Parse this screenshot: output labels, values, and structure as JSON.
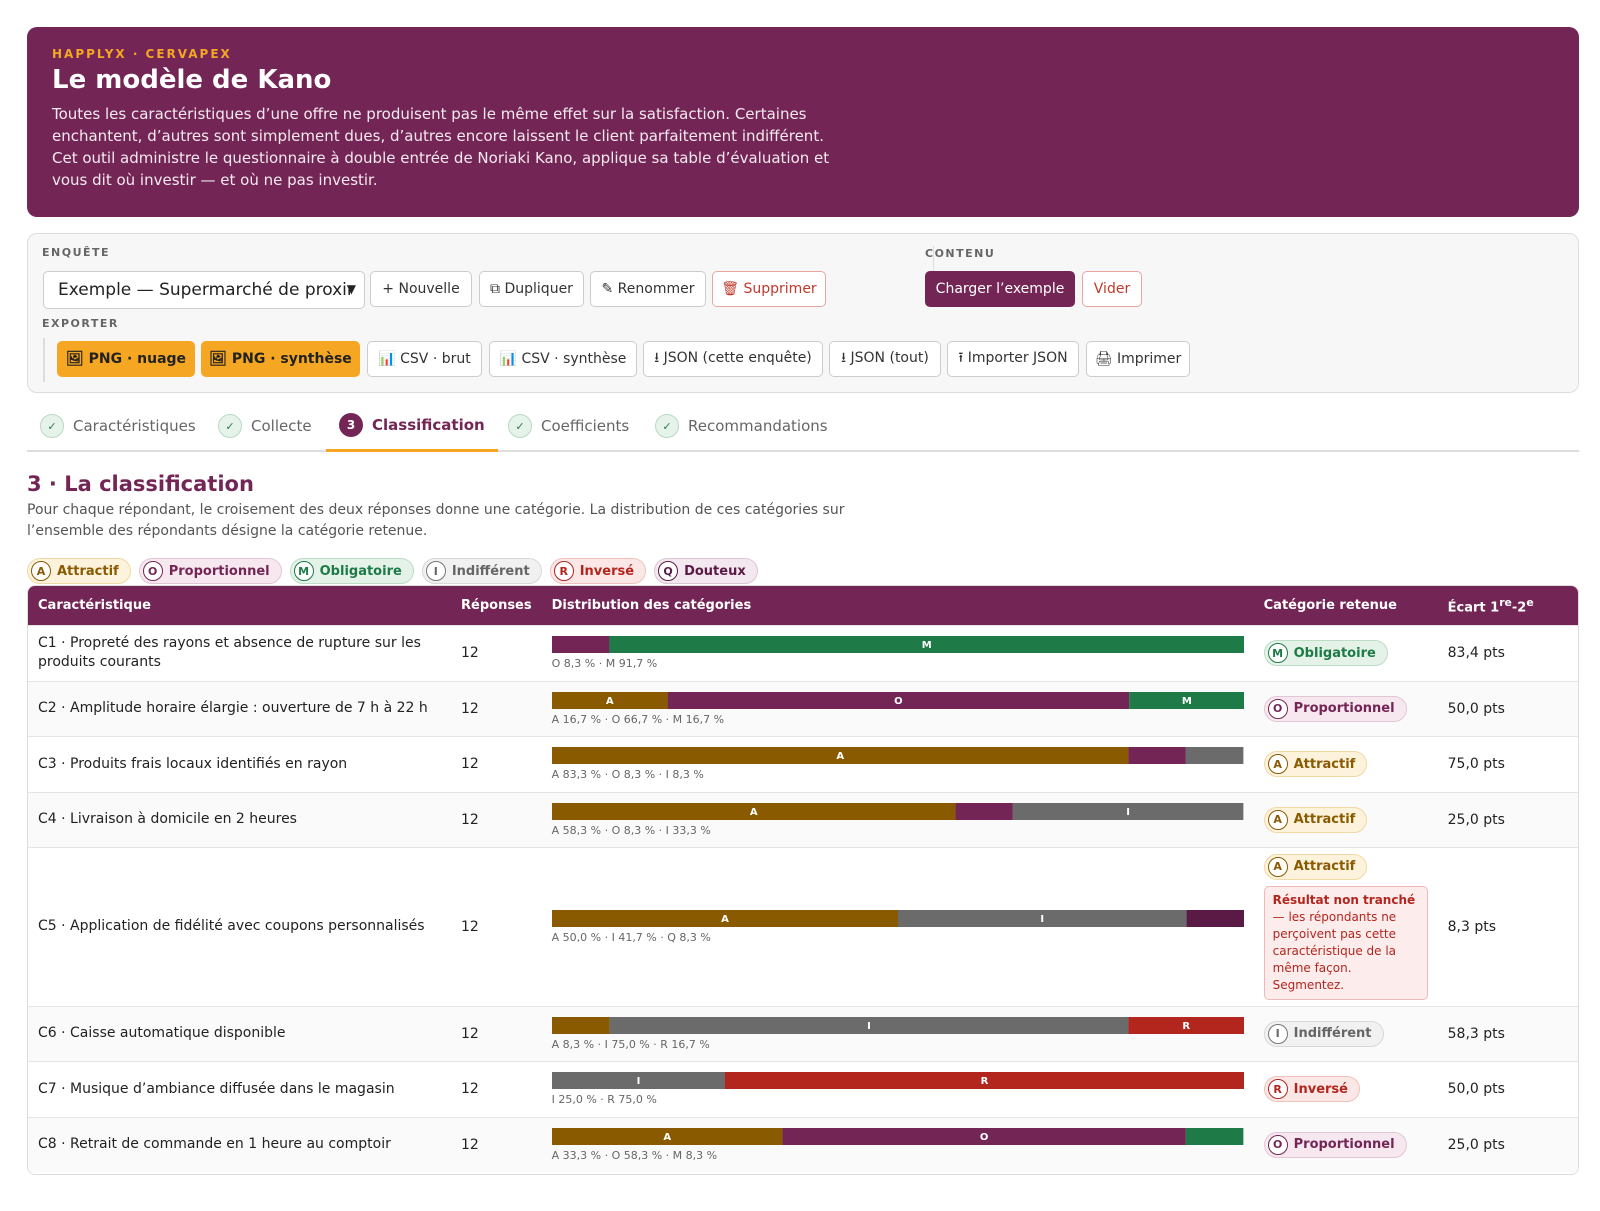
{
  "header": {
    "brand": "HAPPLYX · CERVAPEX",
    "title": "Le modèle de Kano",
    "description": "Toutes les caractéristiques d’une offre ne produisent pas le même effet sur la satisfaction. Certaines enchantent, d’autres sont simplement dues, d’autres encore laissent le client parfaitement indifférent. Cet outil administre le questionnaire à double entrée de Noriaki Kano, applique sa table d’évaluation et vous dit où investir — et où ne pas investir."
  },
  "survey": {
    "label": "ENQUÊTE",
    "selected": "Exemple — Supermarché de proxir",
    "new": "+ Nouvelle",
    "duplicate": "⧉ Dupliquer",
    "rename": "✎ Renommer",
    "delete": "🗑 Supprimer"
  },
  "content": {
    "label": "CONTENU",
    "load": "Charger l’exemple",
    "clear": "Vider"
  },
  "export": {
    "label": "EXPORTER",
    "png_cloud": "🖼 PNG · nuage",
    "png_summary": "🖼 PNG · synthèse",
    "csv_raw": "📊 CSV · brut",
    "csv_summary": "📊 CSV · synthèse",
    "json_survey": "⭳ JSON (cette enquête)",
    "json_all": "⭳ JSON (tout)",
    "import_json": "⭱ Importer JSON",
    "print": "🖨 Imprimer"
  },
  "tabs": [
    {
      "label": "Caractéristiques",
      "mark": "✓"
    },
    {
      "label": "Collecte",
      "mark": "✓"
    },
    {
      "label": "Classification",
      "mark": "3"
    },
    {
      "label": "Coefficients",
      "mark": "✓"
    },
    {
      "label": "Recommandations",
      "mark": "✓"
    }
  ],
  "section": {
    "title": "3 · La classification",
    "description": "Pour chaque répondant, le croisement des deux réponses donne une catégorie. La distribution de ces catégories sur l’ensemble des répondants désigne la catégorie retenue."
  },
  "categories": {
    "A": {
      "letter": "A",
      "label": "Attractif",
      "color": "#8a5a00"
    },
    "O": {
      "letter": "O",
      "label": "Proportionnel",
      "color": "#732655"
    },
    "M": {
      "letter": "M",
      "label": "Obligatoire",
      "color": "#1e7a47"
    },
    "I": {
      "letter": "I",
      "label": "Indifférent",
      "color": "#6b6b6b"
    },
    "R": {
      "letter": "R",
      "label": "Inversé",
      "color": "#b3261e"
    },
    "Q": {
      "letter": "Q",
      "label": "Douteux",
      "color": "#5a1a45"
    }
  },
  "table": {
    "headers": {
      "name": "Caractéristique",
      "responses": "Réponses",
      "distribution": "Distribution des catégories",
      "category": "Catégorie retenue",
      "gap": "Écart 1",
      "gap_sup1": "re",
      "gap_mid": "-2",
      "gap_sup2": "e"
    },
    "rows": [
      {
        "name": "C1 · Propreté des rayons et absence de rupture sur les produits courants",
        "responses": "12",
        "segments": [
          {
            "cat": "O",
            "pct": 8.3
          },
          {
            "cat": "M",
            "pct": 91.7
          }
        ],
        "caption": "O 8,3 % · M 91,7 %",
        "category": "M",
        "gap": "83,4 pts"
      },
      {
        "name": "C2 · Amplitude horaire élargie : ouverture de 7 h à 22 h",
        "responses": "12",
        "segments": [
          {
            "cat": "A",
            "pct": 16.7
          },
          {
            "cat": "O",
            "pct": 66.7
          },
          {
            "cat": "M",
            "pct": 16.7
          }
        ],
        "caption": "A 16,7 % · O 66,7 % · M 16,7 %",
        "category": "O",
        "gap": "50,0 pts"
      },
      {
        "name": "C3 · Produits frais locaux identifiés en rayon",
        "responses": "12",
        "segments": [
          {
            "cat": "A",
            "pct": 83.3
          },
          {
            "cat": "O",
            "pct": 8.3
          },
          {
            "cat": "I",
            "pct": 8.3
          }
        ],
        "caption": "A 83,3 % · O 8,3 % · I 8,3 %",
        "category": "A",
        "gap": "75,0 pts"
      },
      {
        "name": "C4 · Livraison à domicile en 2 heures",
        "responses": "12",
        "segments": [
          {
            "cat": "A",
            "pct": 58.3
          },
          {
            "cat": "O",
            "pct": 8.3
          },
          {
            "cat": "I",
            "pct": 33.3
          }
        ],
        "caption": "A 58,3 % · O 8,3 % · I 33,3 %",
        "category": "A",
        "gap": "25,0 pts"
      },
      {
        "name": "C5 · Application de fidélité avec coupons personnalisés",
        "responses": "12",
        "segments": [
          {
            "cat": "A",
            "pct": 50.0
          },
          {
            "cat": "I",
            "pct": 41.7
          },
          {
            "cat": "Q",
            "pct": 8.3
          }
        ],
        "caption": "A 50,0 % · I 41,7 % · Q 8,3 %",
        "category": "A",
        "gap": "8,3 pts",
        "warning_title": "Résultat non tranché",
        "warning_text": "— les répondants ne perçoivent pas cette caractéristique de la même façon. Segmentez."
      },
      {
        "name": "C6 · Caisse automatique disponible",
        "responses": "12",
        "segments": [
          {
            "cat": "A",
            "pct": 8.3
          },
          {
            "cat": "I",
            "pct": 75.0
          },
          {
            "cat": "R",
            "pct": 16.7
          }
        ],
        "caption": "A 8,3 % · I 75,0 % · R 16,7 %",
        "category": "I",
        "gap": "58,3 pts"
      },
      {
        "name": "C7 · Musique d’ambiance diffusée dans le magasin",
        "responses": "12",
        "segments": [
          {
            "cat": "I",
            "pct": 25.0
          },
          {
            "cat": "R",
            "pct": 75.0
          }
        ],
        "caption": "I 25,0 % · R 75,0 %",
        "category": "R",
        "gap": "50,0 pts"
      },
      {
        "name": "C8 · Retrait de commande en 1 heure au comptoir",
        "responses": "12",
        "segments": [
          {
            "cat": "A",
            "pct": 33.3
          },
          {
            "cat": "O",
            "pct": 58.3
          },
          {
            "cat": "M",
            "pct": 8.3
          }
        ],
        "caption": "A 33,3 % · O 58,3 % · M 8,3 %",
        "category": "O",
        "gap": "25,0 pts"
      }
    ]
  }
}
